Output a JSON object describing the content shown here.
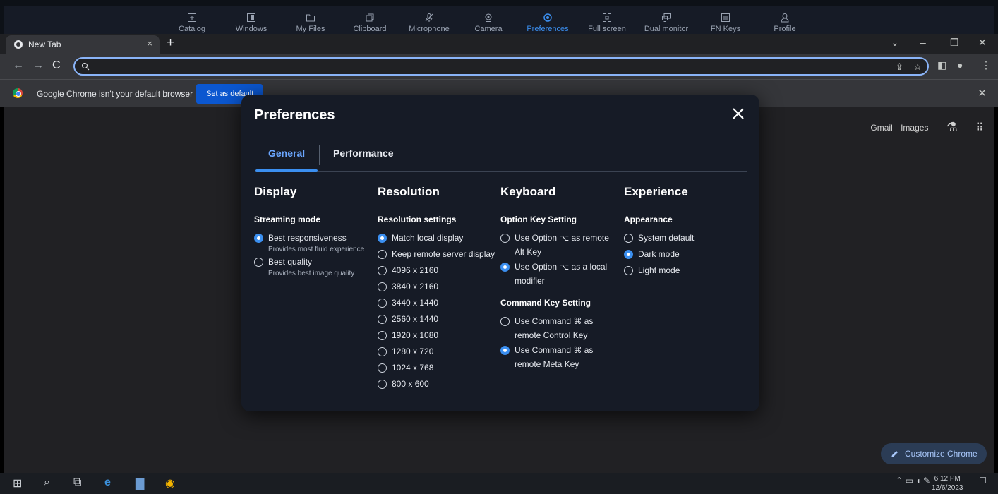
{
  "toolbar": {
    "items": [
      {
        "label": "Catalog",
        "icon": "plus-square-icon"
      },
      {
        "label": "Windows",
        "icon": "window-icon"
      },
      {
        "label": "My Files",
        "icon": "folder-icon"
      },
      {
        "label": "Clipboard",
        "icon": "clipboard-icon"
      },
      {
        "label": "Microphone",
        "icon": "microphone-off-icon"
      },
      {
        "label": "Camera",
        "icon": "camera-icon"
      },
      {
        "label": "Preferences",
        "icon": "gear-icon"
      },
      {
        "label": "Full screen",
        "icon": "fullscreen-icon"
      },
      {
        "label": "Dual monitor",
        "icon": "dual-monitor-icon"
      },
      {
        "label": "FN Keys",
        "icon": "keyboard-icon"
      },
      {
        "label": "Profile",
        "icon": "user-icon"
      }
    ],
    "active": "Preferences"
  },
  "browser": {
    "tab_title": "New Tab",
    "infobar_message": "Google Chrome isn't your default browser",
    "infobar_button": "Set as default",
    "shortcut_gmail": "Gmail",
    "shortcut_images": "Images",
    "customize": "Customize Chrome"
  },
  "taskbar": {
    "time": "6:12 PM",
    "date": "12/6/2023"
  },
  "modal": {
    "title": "Preferences",
    "tabs": [
      "General",
      "Performance"
    ],
    "display": {
      "heading": "Display",
      "subheading": "Streaming mode",
      "options": [
        {
          "label": "Best responsiveness",
          "desc": "Provides most fluid experience",
          "selected": true
        },
        {
          "label": "Best quality",
          "desc": "Provides best image quality",
          "selected": false
        }
      ]
    },
    "resolution": {
      "heading": "Resolution",
      "subheading": "Resolution settings",
      "options": [
        {
          "label": "Match local display",
          "selected": true
        },
        {
          "label": "Keep remote server display",
          "selected": false
        },
        {
          "label": "4096 x 2160",
          "selected": false
        },
        {
          "label": "3840 x 2160",
          "selected": false
        },
        {
          "label": "3440 x 1440",
          "selected": false
        },
        {
          "label": "2560 x 1440",
          "selected": false
        },
        {
          "label": "1920 x 1080",
          "selected": false
        },
        {
          "label": "1280 x 720",
          "selected": false
        },
        {
          "label": "1024 x 768",
          "selected": false
        },
        {
          "label": "800 x 600",
          "selected": false
        }
      ]
    },
    "keyboard": {
      "heading": "Keyboard",
      "option_key": {
        "subheading": "Option Key Setting",
        "options": [
          {
            "line1": "Use Option ⌥ as remote",
            "line2": "Alt Key",
            "selected": false
          },
          {
            "line1": "Use Option ⌥ as a local",
            "line2": "modifier",
            "selected": true
          }
        ]
      },
      "command_key": {
        "subheading": "Command Key Setting",
        "options": [
          {
            "line1": "Use Command ⌘ as",
            "line2": "remote Control Key",
            "selected": false
          },
          {
            "line1": "Use Command ⌘ as",
            "line2": "remote Meta Key",
            "selected": true
          }
        ]
      }
    },
    "experience": {
      "heading": "Experience",
      "subheading": "Appearance",
      "options": [
        {
          "label": "System default",
          "selected": false
        },
        {
          "label": "Dark mode",
          "selected": true
        },
        {
          "label": "Light mode",
          "selected": false
        }
      ]
    }
  },
  "colors": {
    "accent": "#3b8ff0",
    "modal_bg": "#161b26",
    "chrome_dark": "#35363a"
  }
}
